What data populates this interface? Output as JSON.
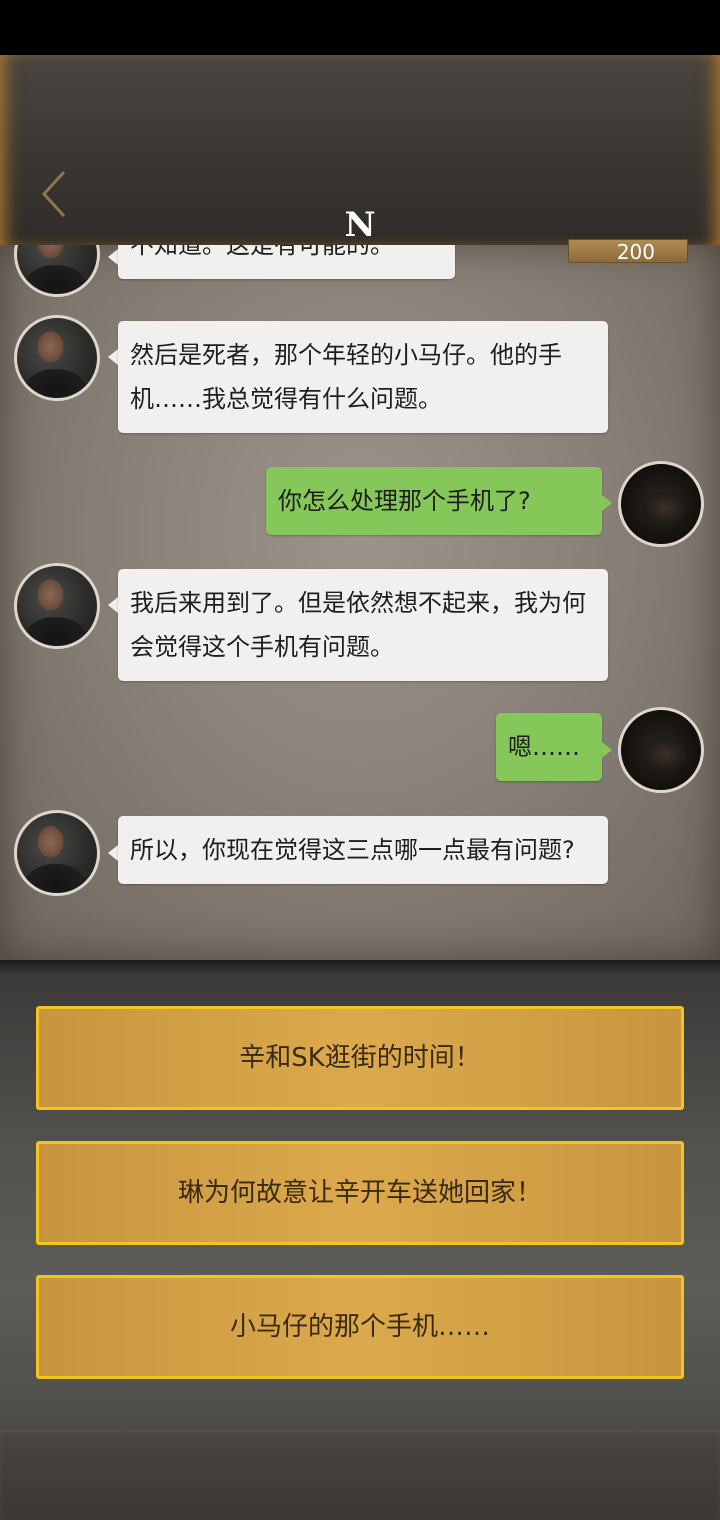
{
  "header": {
    "title": "N",
    "coins": "200"
  },
  "messages": [
    {
      "side": "left",
      "text": "不知道。这是有可能的。"
    },
    {
      "side": "left",
      "text": "然后是死者，那个年轻的小马仔。他的手机……我总觉得有什么问题。"
    },
    {
      "side": "right",
      "text": "你怎么处理那个手机了?"
    },
    {
      "side": "left",
      "text": "我后来用到了。但是依然想不起来，我为何会觉得这个手机有问题。"
    },
    {
      "side": "right",
      "text": "嗯……"
    },
    {
      "side": "left",
      "text": "所以，你现在觉得这三点哪一点最有问题?"
    }
  ],
  "options": [
    {
      "label": "辛和SK逛街的时间！"
    },
    {
      "label": "琳为何故意让辛开车送她回家！"
    },
    {
      "label": "小马仔的那个手机……"
    }
  ],
  "colors": {
    "bubble_left": "#f1f0ee",
    "bubble_right": "#86c75a",
    "option_border": "#f2c51e",
    "option_fill": "#dcaa4c"
  },
  "icons": {
    "back": "chevron-left-icon",
    "avatar_npc": "avatar-man",
    "avatar_player": "avatar-dark"
  }
}
